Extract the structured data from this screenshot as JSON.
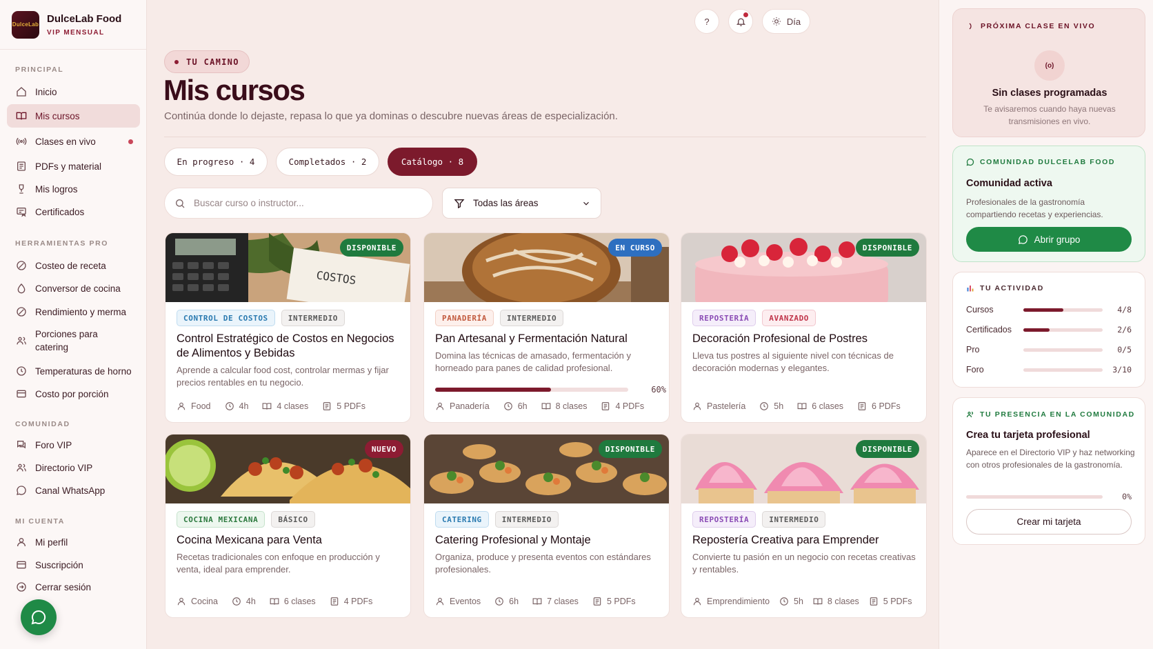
{
  "brand": {
    "name": "DulceLab Food",
    "plan": "VIP MENSUAL",
    "logo_text": "DulceLab"
  },
  "sidebar": {
    "sections": {
      "principal": "PRINCIPAL",
      "herramientas": "HERRAMIENTAS PRO",
      "comunidad": "COMUNIDAD",
      "cuenta": "MI CUENTA"
    },
    "principal": [
      {
        "label": "Inicio"
      },
      {
        "label": "Mis cursos"
      },
      {
        "label": "Clases en vivo"
      },
      {
        "label": "PDFs y material"
      },
      {
        "label": "Mis logros"
      },
      {
        "label": "Certificados"
      }
    ],
    "herramientas": [
      {
        "label": "Costeo de receta"
      },
      {
        "label": "Conversor de cocina"
      },
      {
        "label": "Rendimiento y merma"
      },
      {
        "label": "Porciones para catering"
      },
      {
        "label": "Temperaturas de horno"
      },
      {
        "label": "Costo por porción"
      }
    ],
    "comunidad": [
      {
        "label": "Foro VIP"
      },
      {
        "label": "Directorio VIP"
      },
      {
        "label": "Canal WhatsApp"
      }
    ],
    "cuenta": [
      {
        "label": "Mi perfil"
      },
      {
        "label": "Suscripción"
      },
      {
        "label": "Cerrar sesión"
      }
    ]
  },
  "topbar": {
    "help": "?",
    "theme_label": "Día"
  },
  "header": {
    "pill": "TU CAMINO",
    "title": "Mis cursos",
    "subtitle": "Continúa donde lo dejaste, repasa lo que ya dominas o descubre nuevas áreas de especialización."
  },
  "tabs": [
    {
      "label": "En progreso · 4"
    },
    {
      "label": "Completados · 2"
    },
    {
      "label": "Catálogo · 8"
    }
  ],
  "search": {
    "placeholder": "Buscar curso o instructor..."
  },
  "filter": {
    "selected": "Todas las áreas"
  },
  "courses": [
    {
      "badge": "DISPONIBLE",
      "tag1": "CONTROL DE COSTOS",
      "tag2": "INTERMEDIO",
      "title": "Control Estratégico de Costos en Negocios de Alimentos y Bebidas",
      "desc": "Aprende a calcular food cost, controlar mermas y fijar precios rentables en tu negocio.",
      "area": "Food",
      "hours": "4h",
      "classes": "4 clases",
      "pdfs": "5 PDFs",
      "image_text": "COSTOS"
    },
    {
      "badge": "EN CURSO",
      "tag1": "PANADERÍA",
      "tag2": "INTERMEDIO",
      "title": "Pan Artesanal y Fermentación Natural",
      "desc": "Domina las técnicas de amasado, fermentación y horneado para panes de calidad profesional.",
      "area": "Panadería",
      "hours": "6h",
      "classes": "8 clases",
      "pdfs": "4 PDFs",
      "progress": 60,
      "progress_label": "60%"
    },
    {
      "badge": "DISPONIBLE",
      "tag1": "REPOSTERÍA",
      "tag2": "AVANZADO",
      "title": "Decoración Profesional de Postres",
      "desc": "Lleva tus postres al siguiente nivel con técnicas de decoración modernas y elegantes.",
      "area": "Pastelería",
      "hours": "5h",
      "classes": "6 clases",
      "pdfs": "6 PDFs"
    },
    {
      "badge": "NUEVO",
      "tag1": "COCINA MEXICANA",
      "tag2": "BÁSICO",
      "title": "Cocina Mexicana para Venta",
      "desc": "Recetas tradicionales con enfoque en producción y venta, ideal para emprender.",
      "area": "Cocina",
      "hours": "4h",
      "classes": "6 clases",
      "pdfs": "4 PDFs"
    },
    {
      "badge": "DISPONIBLE",
      "tag1": "CATERING",
      "tag2": "INTERMEDIO",
      "title": "Catering Profesional y Montaje",
      "desc": "Organiza, produce y presenta eventos con estándares profesionales.",
      "area": "Eventos",
      "hours": "6h",
      "classes": "7 clases",
      "pdfs": "5 PDFs"
    },
    {
      "badge": "DISPONIBLE",
      "tag1": "REPOSTERÍA",
      "tag2": "INTERMEDIO",
      "title": "Repostería Creativa para Emprender",
      "desc": "Convierte tu pasión en un negocio con recetas creativas y rentables.",
      "area": "Emprendimiento",
      "hours": "5h",
      "classes": "8 clases",
      "pdfs": "5 PDFs"
    }
  ],
  "right": {
    "live": {
      "label": "PRÓXIMA CLASE EN VIVO",
      "icon_text": "(o)",
      "title": "Sin clases programadas",
      "desc": "Te avisaremos cuando haya nuevas transmisiones en vivo."
    },
    "community": {
      "label": "COMUNIDAD DULCELAB FOOD",
      "title": "Comunidad activa",
      "desc": "Profesionales de la gastronomía compartiendo recetas y experiencias.",
      "button": "Abrir grupo"
    },
    "activity": {
      "label": "TU ACTIVIDAD",
      "rows": [
        {
          "label": "Cursos",
          "value": "4/8",
          "fraction": 0.5
        },
        {
          "label": "Certificados",
          "value": "2/6",
          "fraction": 0.333
        },
        {
          "label": "Pro",
          "value": "0/5",
          "fraction": 0
        },
        {
          "label": "Foro",
          "value": "3/10",
          "fraction": 0
        }
      ]
    },
    "presence": {
      "label": "TU PRESENCIA EN LA COMUNIDAD",
      "title": "Crea tu tarjeta profesional",
      "desc": "Aparece en el Directorio VIP y haz networking con otros profesionales de la gastronomía.",
      "progress_label": "0%",
      "progress": 0,
      "button": "Crear mi tarjeta"
    }
  },
  "colors": {
    "accent": "#7c1a2c",
    "whatsapp": "#1f8a46",
    "bg": "#f7ebe8"
  }
}
